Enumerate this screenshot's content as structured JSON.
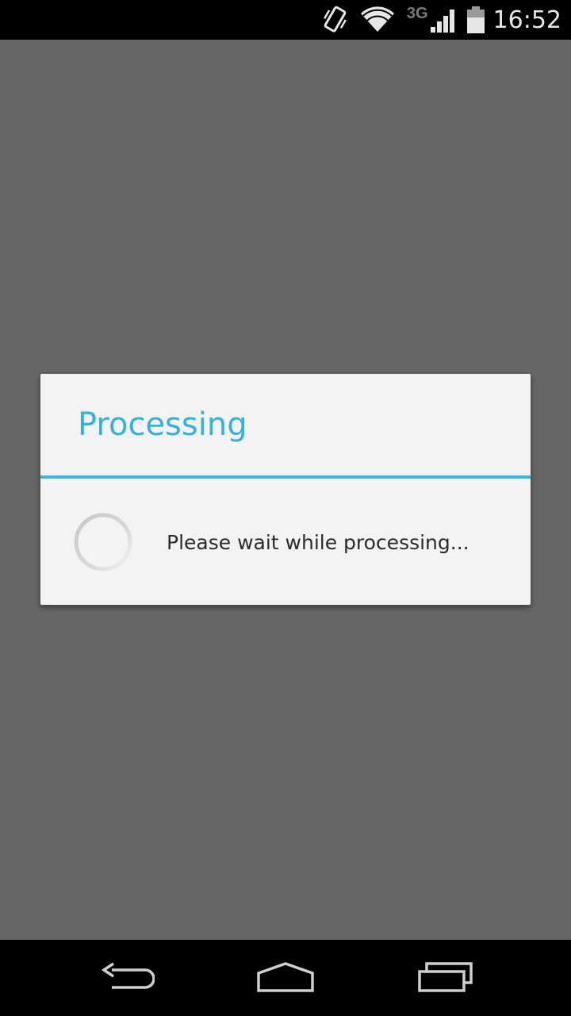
{
  "status_bar": {
    "network_type": "3G",
    "time": "16:52",
    "icons": [
      "vibrate-icon",
      "wifi-icon",
      "signal-icon",
      "battery-icon"
    ]
  },
  "dialog": {
    "title": "Processing",
    "message": "Please wait while processing...",
    "accent_color": "#35b2d9"
  },
  "nav_bar": {
    "buttons": [
      "back-icon",
      "home-icon",
      "recent-apps-icon"
    ]
  }
}
